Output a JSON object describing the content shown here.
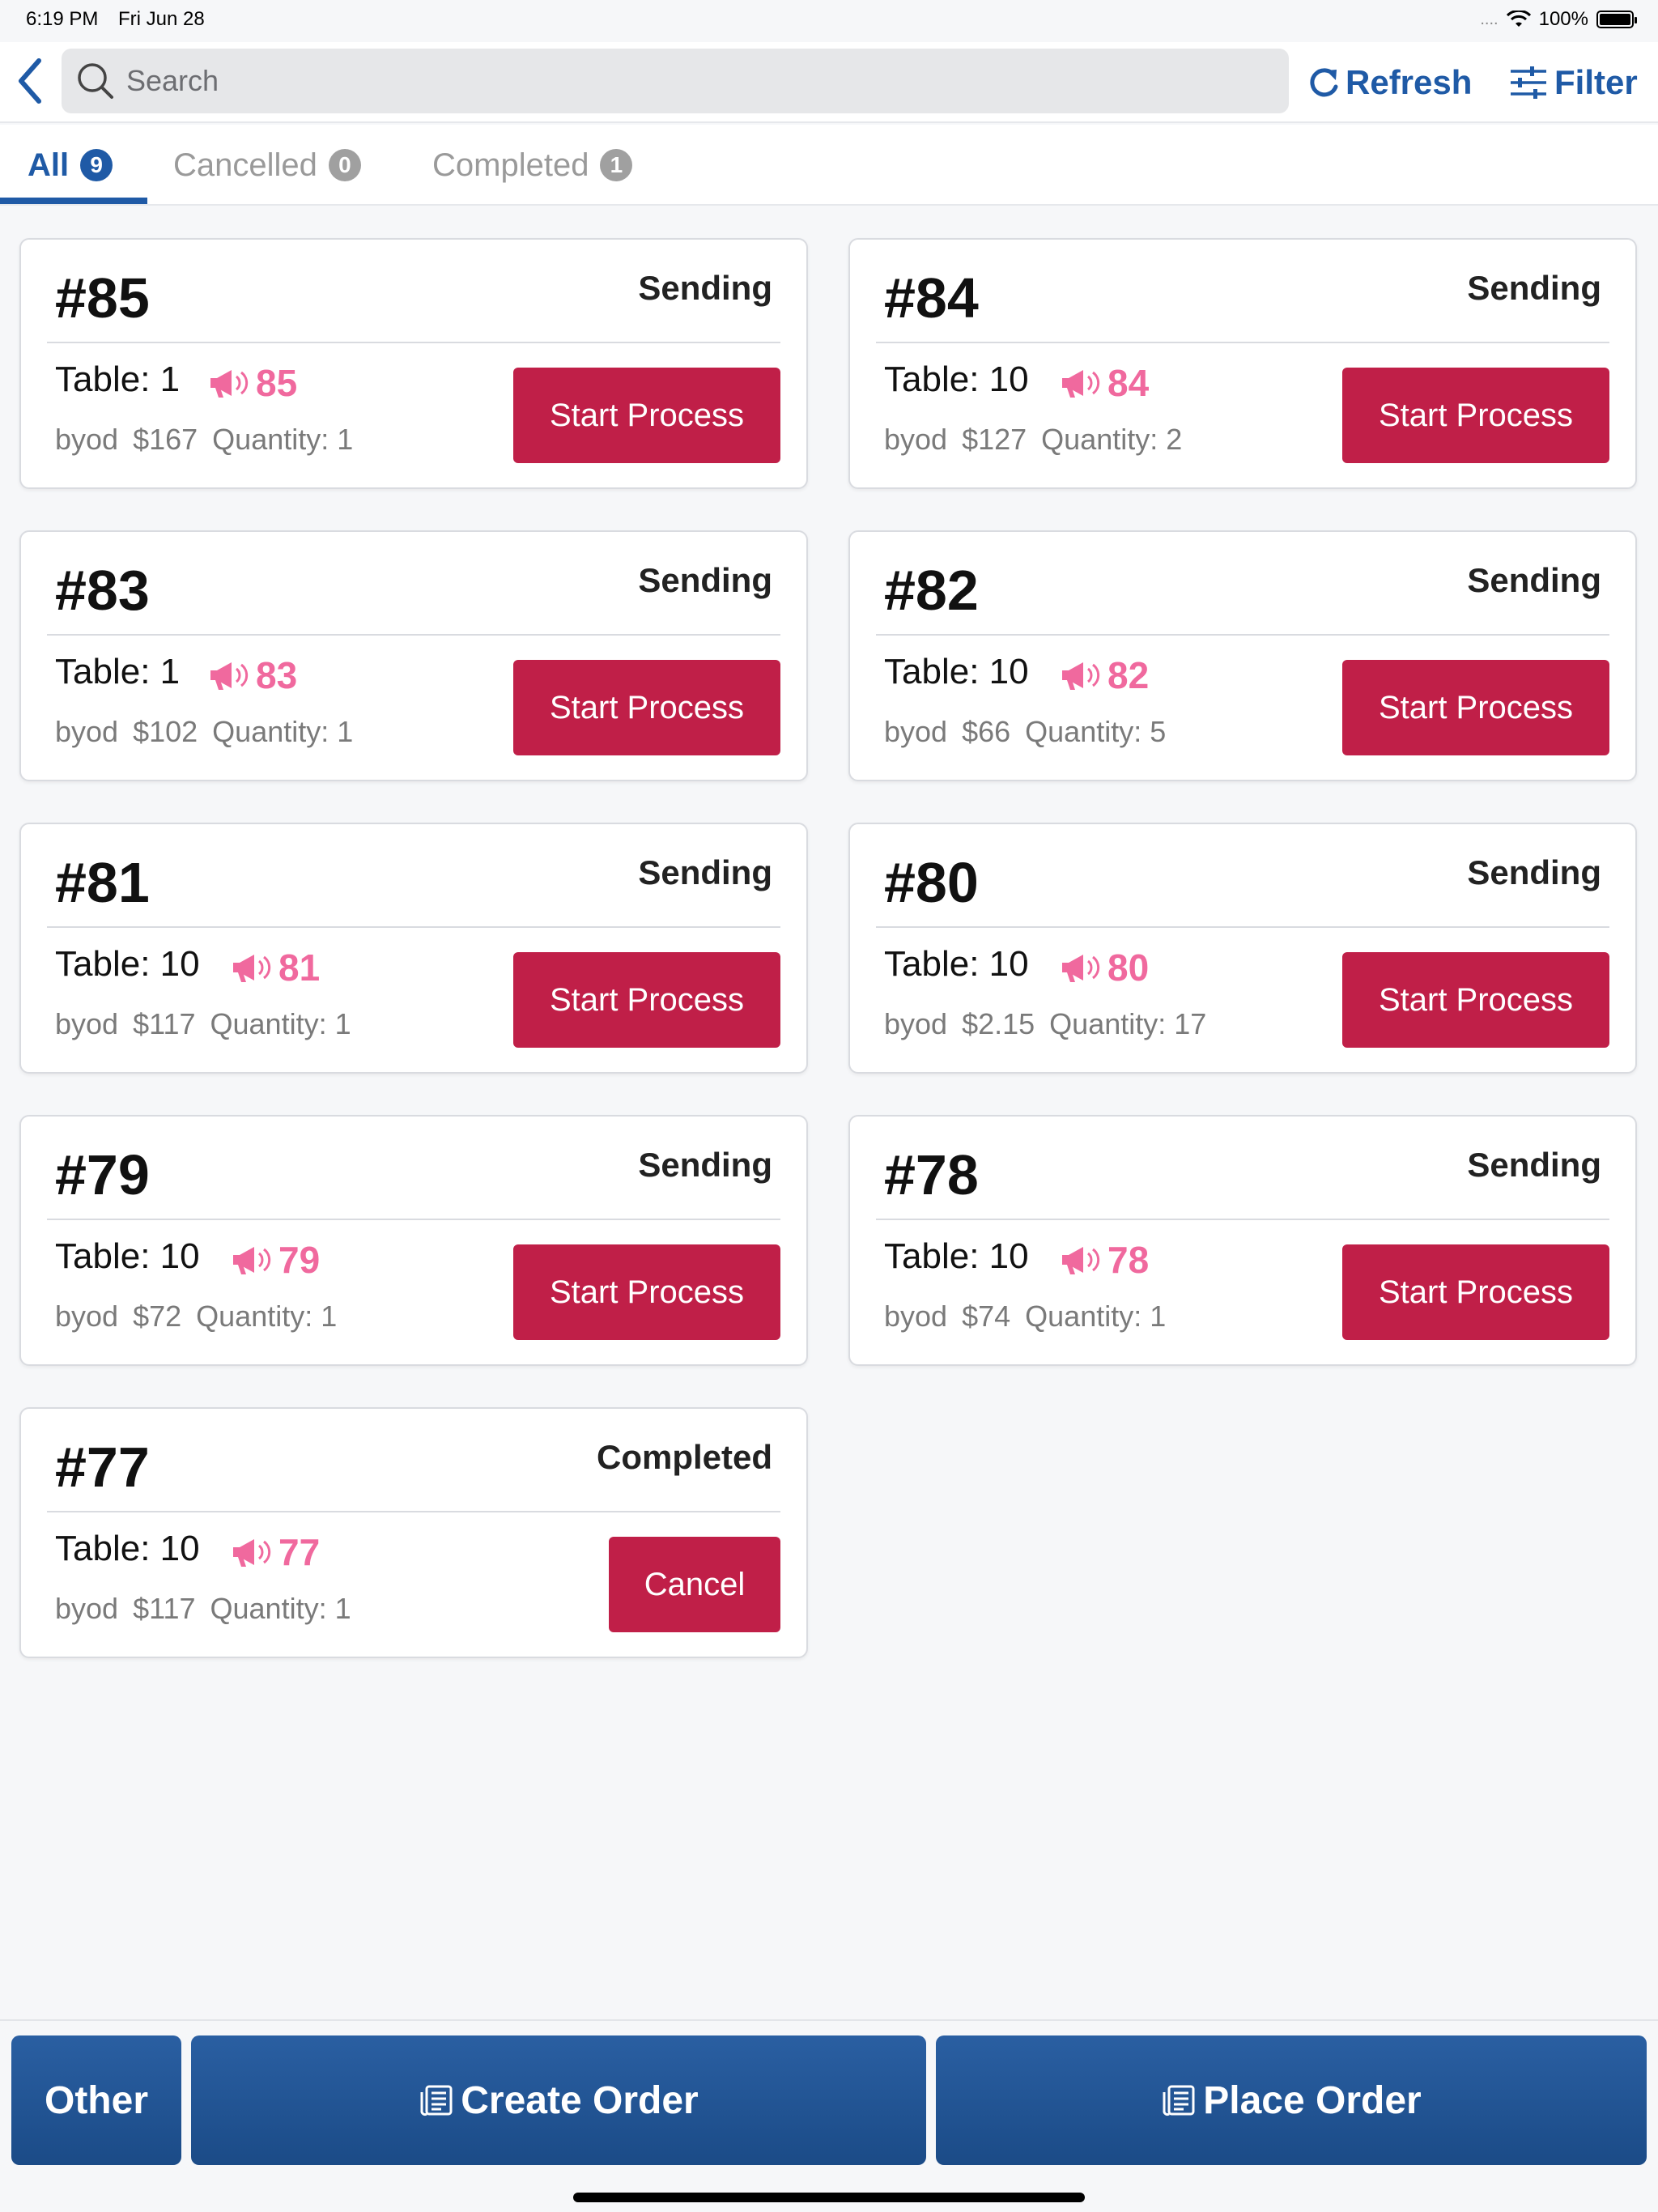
{
  "status_bar": {
    "time": "6:19 PM",
    "date": "Fri Jun 28",
    "dots": "....",
    "battery": "100%"
  },
  "header": {
    "search_placeholder": "Search",
    "refresh_label": "Refresh",
    "filter_label": "Filter",
    "accent_color": "#1f5aa6"
  },
  "tabs": [
    {
      "label": "All",
      "count": "9",
      "active": true
    },
    {
      "label": "Cancelled",
      "count": "0",
      "active": false
    },
    {
      "label": "Completed",
      "count": "1",
      "active": false
    }
  ],
  "orders": [
    {
      "number": "#85",
      "status": "Sending",
      "table": "Table: 1",
      "call": "85",
      "source": "byod",
      "price": "$167",
      "quantity": "Quantity: 1",
      "action": "Start Process"
    },
    {
      "number": "#84",
      "status": "Sending",
      "table": "Table: 10",
      "call": "84",
      "source": "byod",
      "price": "$127",
      "quantity": "Quantity: 2",
      "action": "Start Process"
    },
    {
      "number": "#83",
      "status": "Sending",
      "table": "Table: 1",
      "call": "83",
      "source": "byod",
      "price": "$102",
      "quantity": "Quantity: 1",
      "action": "Start Process"
    },
    {
      "number": "#82",
      "status": "Sending",
      "table": "Table: 10",
      "call": "82",
      "source": "byod",
      "price": "$66",
      "quantity": "Quantity: 5",
      "action": "Start Process"
    },
    {
      "number": "#81",
      "status": "Sending",
      "table": "Table: 10",
      "call": "81",
      "source": "byod",
      "price": "$117",
      "quantity": "Quantity: 1",
      "action": "Start Process"
    },
    {
      "number": "#80",
      "status": "Sending",
      "table": "Table: 10",
      "call": "80",
      "source": "byod",
      "price": "$2.15",
      "quantity": "Quantity: 17",
      "action": "Start Process"
    },
    {
      "number": "#79",
      "status": "Sending",
      "table": "Table: 10",
      "call": "79",
      "source": "byod",
      "price": "$72",
      "quantity": "Quantity: 1",
      "action": "Start Process"
    },
    {
      "number": "#78",
      "status": "Sending",
      "table": "Table: 10",
      "call": "78",
      "source": "byod",
      "price": "$74",
      "quantity": "Quantity: 1",
      "action": "Start Process"
    },
    {
      "number": "#77",
      "status": "Completed",
      "table": "Table: 10",
      "call": "77",
      "source": "byod",
      "price": "$117",
      "quantity": "Quantity: 1",
      "action": "Cancel"
    }
  ],
  "bottom_bar": {
    "other_label": "Other",
    "create_label": "Create Order",
    "place_label": "Place Order"
  },
  "colors": {
    "action_red": "#c01f48",
    "call_pink": "#f0699e",
    "bottom_blue": "#1f5aa6"
  },
  "icons": {
    "back": "chevron-left-icon",
    "search": "search-icon",
    "refresh": "refresh-icon",
    "filter": "sliders-icon",
    "call": "megaphone-icon",
    "order": "receipt-icon"
  }
}
